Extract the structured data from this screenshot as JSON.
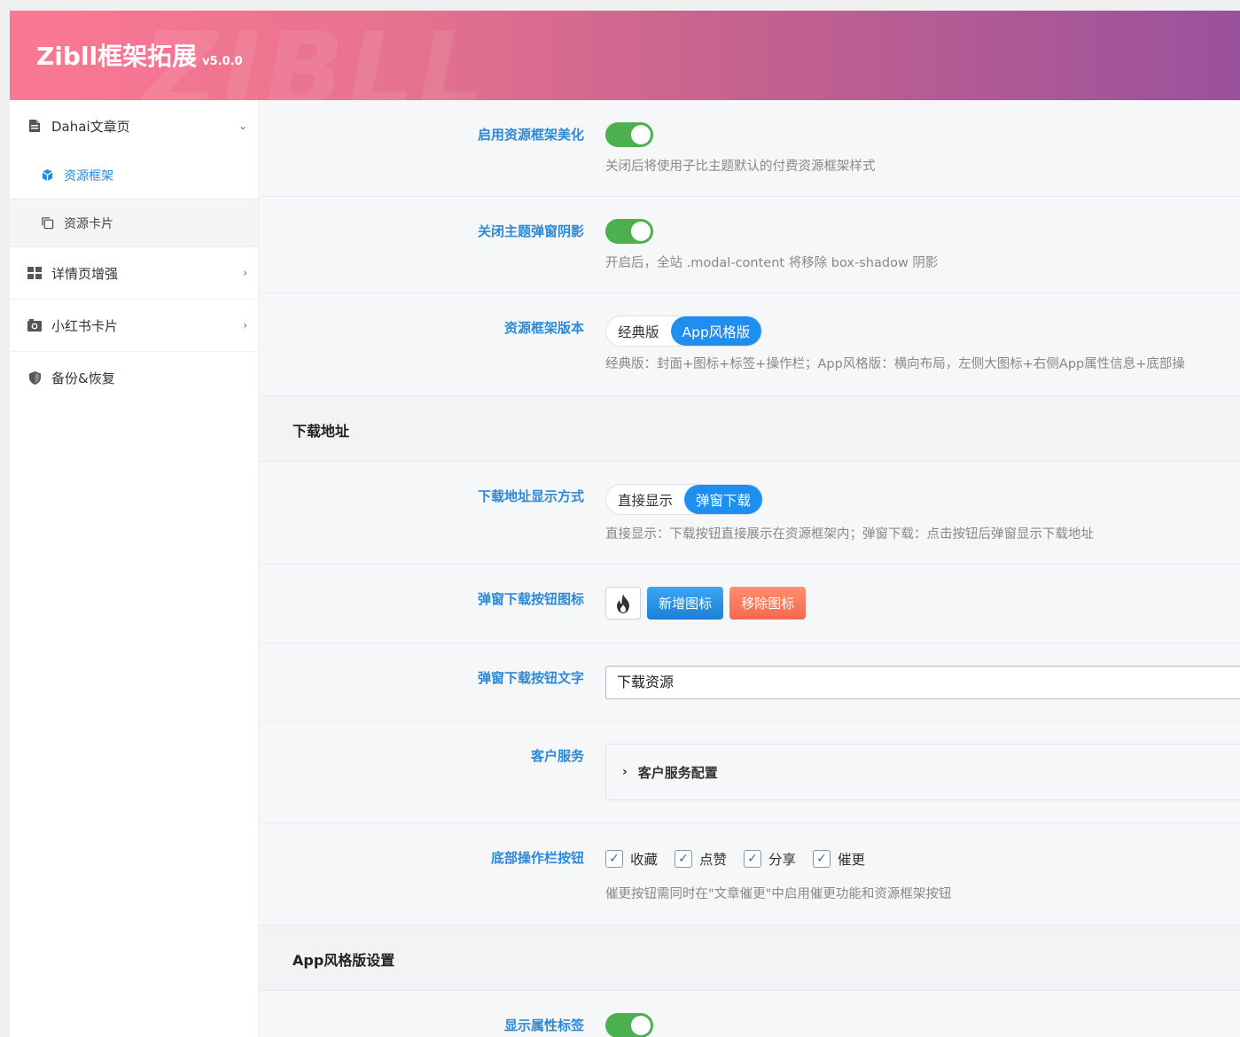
{
  "header": {
    "title": "Zibll框架拓展",
    "version": "v5.0.0",
    "watermark": "ZIBLL"
  },
  "sidebar": {
    "items": [
      {
        "label": "Dahai文章页",
        "icon": "document-icon",
        "chevron": "⌄"
      },
      {
        "label": "资源框架",
        "icon": "cube-icon"
      },
      {
        "label": "资源卡片",
        "icon": "copy-icon"
      },
      {
        "label": "详情页增强",
        "icon": "grid-icon",
        "chevron": "›"
      },
      {
        "label": "小红书卡片",
        "icon": "camera-icon",
        "chevron": "›"
      },
      {
        "label": "备份&恢复",
        "icon": "shield-icon"
      }
    ]
  },
  "fields": {
    "beautify": {
      "label": "启用资源框架美化",
      "enabled": true,
      "desc": "关闭后将使用子比主题默认的付费资源框架样式"
    },
    "shadow": {
      "label": "关闭主题弹窗阴影",
      "enabled": true,
      "desc": "开启后，全站 .modal-content 将移除 box-shadow 阴影"
    },
    "version": {
      "label": "资源框架版本",
      "options": [
        "经典版",
        "App风格版"
      ],
      "selected": "App风格版",
      "desc": "经典版：封面+图标+标签+操作栏；App风格版：横向布局，左侧大图标+右侧App属性信息+底部操"
    },
    "download_section": "下载地址",
    "download_mode": {
      "label": "下载地址显示方式",
      "options": [
        "直接显示",
        "弹窗下载"
      ],
      "selected": "弹窗下载",
      "desc": "直接显示：下载按钮直接展示在资源框架内；弹窗下载：点击按钮后弹窗显示下载地址"
    },
    "download_icon": {
      "label": "弹窗下载按钮图标",
      "icon": "flame-icon",
      "add_label": "新增图标",
      "remove_label": "移除图标"
    },
    "download_text": {
      "label": "弹窗下载按钮文字",
      "value": "下载资源"
    },
    "service": {
      "label": "客户服务",
      "accordion_title": "客户服务配置"
    },
    "toolbar": {
      "label": "底部操作栏按钮",
      "options": [
        "收藏",
        "点赞",
        "分享",
        "催更"
      ],
      "checked": [
        true,
        true,
        true,
        true
      ],
      "desc": "催更按钮需同时在\"文章催更\"中启用催更功能和资源框架按钮"
    },
    "app_section": "App风格版设置",
    "attr_tags": {
      "label": "显示属性标签",
      "enabled": true
    }
  },
  "colors": {
    "accent": "#2c89d9",
    "toggle_on": "#4caf50",
    "segment_on": "#1e8ff0",
    "header_start": "#fb7893",
    "header_end": "#9a519c"
  }
}
